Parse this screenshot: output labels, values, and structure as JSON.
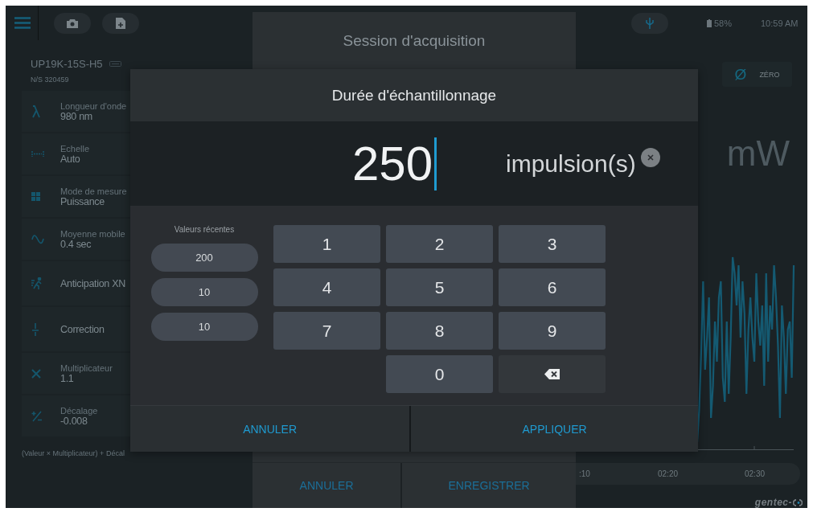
{
  "status_bar": {
    "battery": "58%",
    "time": "10:59 AM"
  },
  "device": {
    "model": "UP19K-15S-H5",
    "serial": "N/S 320459"
  },
  "settings": [
    {
      "kind": "two-line",
      "label": "Longueur d'onde",
      "value": "980 nm"
    },
    {
      "kind": "two-line",
      "label": "Echelle",
      "value": "Auto"
    },
    {
      "kind": "two-line",
      "label": "Mode de mesure",
      "value": "Puissance"
    },
    {
      "kind": "two-line",
      "label": "Moyenne mobile",
      "value": "0.4 sec"
    },
    {
      "kind": "single",
      "value": "Anticipation XN"
    },
    {
      "kind": "single",
      "value": "Correction"
    },
    {
      "kind": "two-line",
      "label": "Multiplicateur",
      "value": "1.1"
    },
    {
      "kind": "two-line",
      "label": "Décalage",
      "value": "-0.008"
    }
  ],
  "footnote": "(Valeur × Multiplicateur) + Décal",
  "zero_button": {
    "symbol": "Ø",
    "label": "ZÉRO"
  },
  "reading": {
    "unit": "mW"
  },
  "chart": {
    "time_labels": [
      ":10",
      "02:20",
      "02:30"
    ]
  },
  "logo": "gentec-",
  "session_dialog": {
    "title": "Session d'acquisition",
    "buttons": [
      "ANNULER",
      "ENREGISTRER"
    ]
  },
  "keypad_dialog": {
    "title": "Durée d'échantillonnage",
    "value": "250",
    "unit": "impulsion(s)",
    "recent_title": "Valeurs récentes",
    "recent_values": [
      "200",
      "10",
      "10"
    ],
    "keys": [
      {
        "kind": "digit",
        "label": "1"
      },
      {
        "kind": "digit",
        "label": "2"
      },
      {
        "kind": "digit",
        "label": "3"
      },
      {
        "kind": "digit",
        "label": "4"
      },
      {
        "kind": "digit",
        "label": "5"
      },
      {
        "kind": "digit",
        "label": "6"
      },
      {
        "kind": "digit",
        "label": "7"
      },
      {
        "kind": "digit",
        "label": "8"
      },
      {
        "kind": "digit",
        "label": "9"
      },
      {
        "kind": "empty"
      },
      {
        "kind": "digit",
        "label": "0"
      },
      {
        "kind": "backspace"
      }
    ],
    "buttons": [
      "ANNULER",
      "APPLIQUER"
    ]
  }
}
